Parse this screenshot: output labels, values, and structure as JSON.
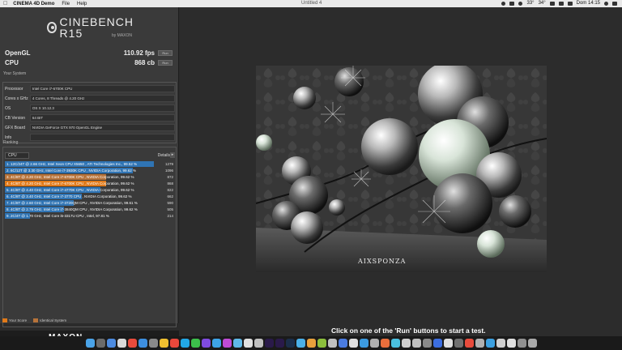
{
  "menubar": {
    "apple_icon": "apple-icon",
    "app_name": "CINEMA 4D Demo",
    "menus": [
      "File",
      "Help"
    ],
    "document_title": "Untitled 4",
    "status": {
      "temp1": "33°",
      "temp2": "34°",
      "clock": "Dom 14:15"
    }
  },
  "benchmark": {
    "logo": "CINEBENCH R15",
    "logo_sub": "by MAXON",
    "opengl": {
      "label": "OpenGL",
      "value": "110.92 fps",
      "run": "Run"
    },
    "cpu": {
      "label": "CPU",
      "value": "868 cb",
      "run": "Run"
    }
  },
  "system": {
    "title": "Your System",
    "rows": [
      {
        "label": "Processor",
        "value": "Intel Core i7-6700K CPU"
      },
      {
        "label": "Cores x GHz",
        "value": "4 Cores, 8 Threads @ 4.20 GHz"
      },
      {
        "label": "OS",
        "value": "OS X 10.12.3"
      },
      {
        "label": "CB Version",
        "value": "64 BIT"
      },
      {
        "label": "GFX Board",
        "value": "NVIDIA GeForce GTX 970 OpenGL Engine"
      },
      {
        "label": "Info",
        "value": ""
      }
    ]
  },
  "ranking": {
    "title": "Ranking",
    "select": "CPU",
    "details": "Details",
    "rows": [
      {
        "text": "1. 12C/24T @ 2.66 GHz, Intel Xeon CPU X5650 , ATI Technologies Inc., 99.52 %",
        "score": "1279",
        "kind": "ref",
        "fill": 1.0
      },
      {
        "text": "2. 6C/12T @ 3.30 GHz, Intel Core i7-3930K CPU , NVIDIA Corporation, 99.62 %",
        "score": "1096",
        "kind": "ref",
        "fill": 0.857
      },
      {
        "text": "3. 4C/8T @ 4.20 GHz, Intel Core i7-6700K CPU , NVIDIA Corporation, 99.62 %",
        "score": "872",
        "kind": "identical",
        "fill": 0.682
      },
      {
        "text": "4. 4C/8T @ 4.20 GHz, Intel Core i7-6700K CPU , NVIDIA Corporation, 99.62 %",
        "score": "868",
        "kind": "yours",
        "fill": 0.679
      },
      {
        "text": "5. 4C/8T @ 4.40 GHz, Intel Core i7-4770K CPU , NVIDIA Corporation, 99.62 %",
        "score": "822",
        "kind": "ref",
        "fill": 0.643
      },
      {
        "text": "6. 4C/8T @ 3.40 GHz, Intel Core i7-3770 CPU , NVIDIA Corporation, 99.62 %",
        "score": "662",
        "kind": "ref",
        "fill": 0.518
      },
      {
        "text": "7. 4C/8T @ 2.60 GHz, Intel Core i7-3720QM CPU , NVIDIA Corporation, 99.61 %",
        "score": "590",
        "kind": "ref",
        "fill": 0.461
      },
      {
        "text": "8. 4C/8T @ 2.79 GHz, Intel Core i7-3840QM CPU , NVIDIA Corporation, 99.62 %",
        "score": "505",
        "kind": "ref",
        "fill": 0.395
      },
      {
        "text": "9. 2C/4T @ 1.70 GHz, Intel Core i5-3317U CPU , Intel, 97.81 %",
        "score": "214",
        "kind": "ref",
        "fill": 0.167
      }
    ],
    "legend": {
      "yours": "Your Score",
      "identical": "Identical System"
    }
  },
  "colors": {
    "ref": "#2f74b4",
    "yours": "#e07a1a",
    "identical": "#b7733a"
  },
  "footer": {
    "brand": "MAXON",
    "tagline": "3D FOR THE REAL WORLD"
  },
  "render": {
    "watermark": "AIXSPONZA"
  },
  "status_message": "Click on one of the 'Run' buttons to start a test.",
  "dock": {
    "icons": [
      "finder-icon",
      "launchpad-icon",
      "app-icon",
      "app-icon",
      "app-icon",
      "app-icon",
      "app-icon",
      "app-icon",
      "chrome-icon",
      "skype-icon",
      "whatsapp-icon",
      "app-icon",
      "app-icon",
      "app-icon",
      "app-icon",
      "app-icon",
      "app-icon",
      "premiere-icon",
      "aftereffects-icon",
      "photoshop-icon",
      "app-icon",
      "app-icon",
      "app-icon",
      "app-icon",
      "app-icon",
      "app-icon",
      "app-icon",
      "app-icon",
      "app-icon",
      "app-icon",
      "app-icon",
      "app-icon",
      "app-icon",
      "app-icon",
      "app-icon",
      "app-icon",
      "app-icon",
      "app-icon",
      "app-icon",
      "app-icon",
      "app-icon",
      "app-icon",
      "trash-icon"
    ],
    "colors": [
      "#4aa3e8",
      "#6b6b6b",
      "#4c8be0",
      "#d9d9d9",
      "#e84b3c",
      "#3d8fe0",
      "#8a8a8a",
      "#f0c030",
      "#e9483b",
      "#22a8e6",
      "#3cc04b",
      "#7f4be0",
      "#3da4e8",
      "#c04bd6",
      "#5fb9e8",
      "#e0e0e0",
      "#c0c0c0",
      "#2a1a4a",
      "#2a1a4a",
      "#1b2e4a",
      "#4ab0e8",
      "#e8a03c",
      "#8cbf3c",
      "#c0c0c0",
      "#4a7be0",
      "#e0e0e0",
      "#3c9be0",
      "#b0b0b0",
      "#e86e3c",
      "#4ac0e0",
      "#d0d0d0",
      "#c0c0c0",
      "#8a8a8a",
      "#3c6ee0",
      "#e0e0e0",
      "#707070",
      "#e84b3c",
      "#b0b0b0",
      "#3ca0e0",
      "#d0d0d0",
      "#e0e0e0",
      "#909090",
      "#aaaaaa"
    ]
  }
}
